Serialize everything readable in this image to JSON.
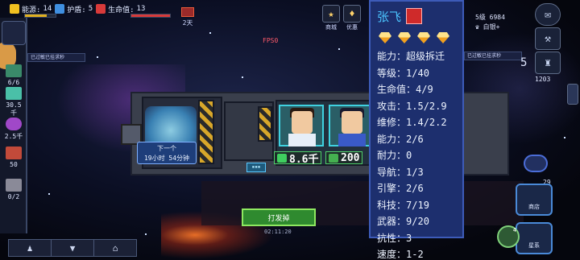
{
  "topbar": {
    "energy_label": "能源:",
    "energy_value": "14",
    "shield_label": "护盾:",
    "shield_value": "5",
    "health_label": "生命值:",
    "health_value": "13",
    "days_label": "2天",
    "energy_level": 0.7,
    "health_level": 1.0
  },
  "top_icons": {
    "store_label": "商城",
    "offer_label": "优惠"
  },
  "fps_text": "FPS0",
  "left_panel": {
    "item1_value": "6/6",
    "item2_value": "30.5千",
    "item3_value": "2.5千",
    "item4_value": "50",
    "item5_value": "0/2",
    "toast_text": "已过敏已挂求秒"
  },
  "ship": {
    "next_label": "下一个",
    "next_time": "19小时 54分钟",
    "resource1_value": "8.6千",
    "resource2_value": "200"
  },
  "launch_button_label": "打发掉",
  "timestamp": "02:11:20",
  "bottom_nav": {
    "crew_icon": "person-icon",
    "shirt_icon": "shirt-icon",
    "home_icon": "house-icon"
  },
  "character": {
    "name": "张飞",
    "rank_gem_count": 4,
    "stats": [
      {
        "label": "能力",
        "value": "超级拆迁"
      },
      {
        "label": "等级",
        "value": "1/40"
      },
      {
        "label": "生命值",
        "value": "4/9"
      },
      {
        "label": "攻击",
        "value": "1.5/2.9"
      },
      {
        "label": "维修",
        "value": "1.4/2.2"
      },
      {
        "label": "能力",
        "value": "2/6"
      },
      {
        "label": "耐力",
        "value": "0"
      },
      {
        "label": "导航",
        "value": "1/3"
      },
      {
        "label": "引擎",
        "value": "2/6"
      },
      {
        "label": "科技",
        "value": "7/19"
      },
      {
        "label": "武器",
        "value": "9/20"
      },
      {
        "label": "抗性",
        "value": "3"
      },
      {
        "label": "速度",
        "value": "1-2"
      }
    ]
  },
  "right_panel": {
    "score_label": "5级",
    "score_value": "6984",
    "rank_label": "白银+",
    "toast_text": "已过敏已挂求秒",
    "level_value": "5",
    "trophy_value": "1203",
    "shop_label": "商店",
    "ship_label": "星系",
    "badge_count": "29"
  }
}
